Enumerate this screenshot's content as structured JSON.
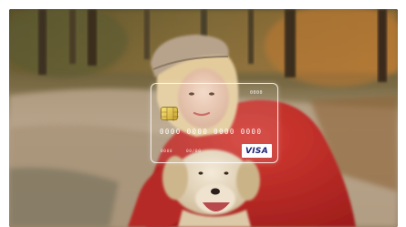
{
  "card": {
    "top_text": "0000",
    "number": "0000 0000 0000 0000",
    "sub_left": "0000",
    "sub_right": "00/00",
    "brand": "VISA"
  },
  "colors": {
    "sweater": "#c0302c",
    "hat": "#b9a58e",
    "hair": "#e7d2a6",
    "dog": "#e9dcc6",
    "visa_blue": "#1a1f71"
  }
}
